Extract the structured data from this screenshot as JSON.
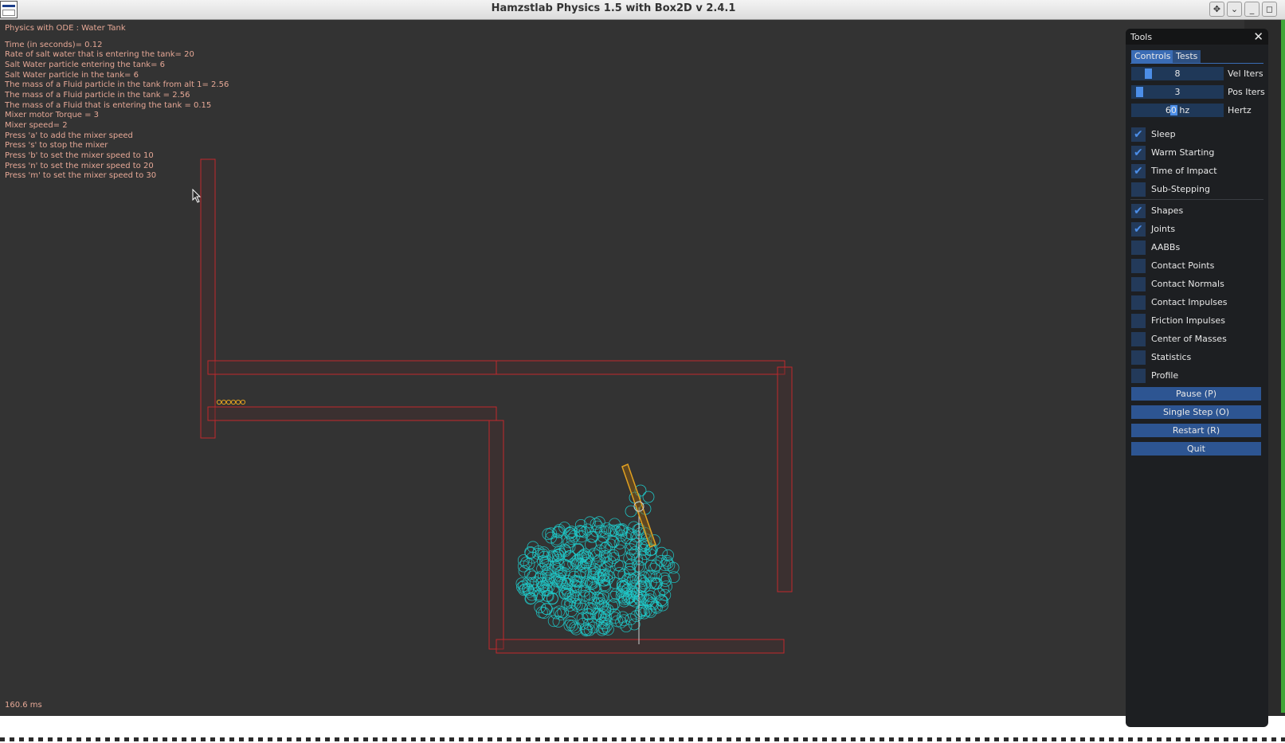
{
  "window": {
    "title": "Hamzstlab Physics 1.5 with Box2D v 2.4.1",
    "buttons": [
      "move-icon",
      "chevron-down-icon",
      "minimize-icon",
      "maximize-icon"
    ]
  },
  "info": {
    "title": "Physics with ODE : Water Tank",
    "lines": [
      "Time (in seconds)= 0.12",
      "Rate of salt water that is entering the tank=   20",
      "Salt Water particle entering the tank=    6",
      "Salt Water particle in the tank=    6",
      "The mass of a Fluid particle in the tank from alt 1= 2.56",
      "The mass of a Fluid particle in the tank = 2.56",
      "The mass of a Fluid that is entering the tank = 0.15",
      "Mixer motor Torque =     3",
      "Mixer speed=     2",
      "Press 'a' to add the mixer speed",
      "Press 's' to stop the mixer",
      "Press 'b' to set the mixer speed to 10",
      "Press 'n' to set the mixer speed to 20",
      "Press 'm' to set the mixer speed to 30"
    ],
    "frame_time": "160.6 ms"
  },
  "tools": {
    "title": "Tools",
    "tabs": [
      "Controls",
      "Tests"
    ],
    "sliders": [
      {
        "value": "8",
        "label": "Vel Iters",
        "fraction": 0.16
      },
      {
        "value": "3",
        "label": "Pos Iters",
        "fraction": 0.06
      },
      {
        "value": "60 hz",
        "label": "Hertz",
        "fraction": 0.46
      }
    ],
    "checkboxes_group1": [
      {
        "label": "Sleep",
        "checked": true
      },
      {
        "label": "Warm Starting",
        "checked": true
      },
      {
        "label": "Time of Impact",
        "checked": true
      },
      {
        "label": "Sub-Stepping",
        "checked": false
      }
    ],
    "checkboxes_group2": [
      {
        "label": "Shapes",
        "checked": true
      },
      {
        "label": "Joints",
        "checked": true
      },
      {
        "label": "AABBs",
        "checked": false
      },
      {
        "label": "Contact Points",
        "checked": false
      },
      {
        "label": "Contact Normals",
        "checked": false
      },
      {
        "label": "Contact Impulses",
        "checked": false
      },
      {
        "label": "Friction Impulses",
        "checked": false
      },
      {
        "label": "Center of Masses",
        "checked": false
      },
      {
        "label": "Statistics",
        "checked": false
      },
      {
        "label": "Profile",
        "checked": false
      }
    ],
    "buttons": [
      "Pause (P)",
      "Single Step (O)",
      "Restart (R)",
      "Quit"
    ]
  },
  "colors": {
    "info_text": "#e6a896",
    "wall_stroke": "#c0282d",
    "wall_fill": "#4a2b2b",
    "particle": "#1fc8c8",
    "mixer": "#e0a020",
    "accent": "#4c8ee8"
  }
}
